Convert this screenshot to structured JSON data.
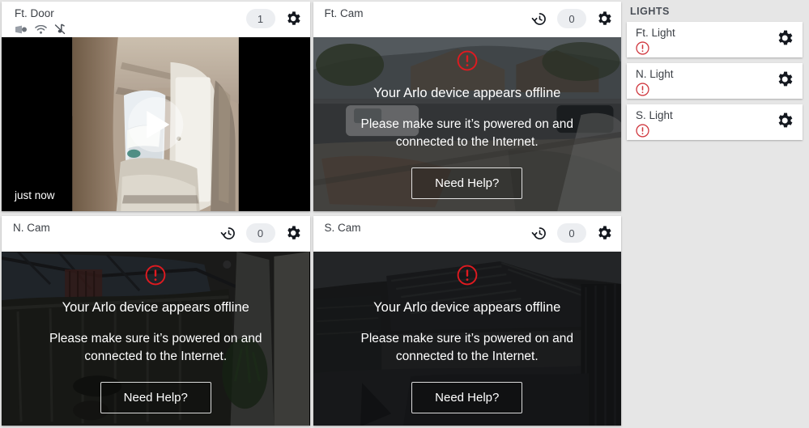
{
  "colors": {
    "page_background": "#e6e6e6",
    "card_background": "#ffffff",
    "status_online": "#3fc9a0",
    "warning_red": "#e01a20",
    "badge_background": "#eceef1",
    "text_primary": "#3b3f45"
  },
  "cameras": [
    {
      "title": "Ft. Door",
      "type": "doorbell",
      "status_bar": true,
      "status_icons": [
        "battery-icon",
        "wifi-icon",
        "audio-muted-icon"
      ],
      "has_history_icon": false,
      "history_icon": "history-icon",
      "badge_count": "1",
      "settings_icon": "gear-icon",
      "timestamp": "just now",
      "play_icon": "play-icon",
      "offline": false
    },
    {
      "title": "Ft. Cam",
      "type": "camera",
      "status_bar": false,
      "status_icons": [],
      "has_history_icon": true,
      "history_icon": "history-icon",
      "badge_count": "0",
      "settings_icon": "gear-icon",
      "offline": true,
      "offline_icon": "warning-circle-icon",
      "offline_title": "Your Arlo device appears offline",
      "offline_sub": "Please make sure it’s powered on and connected to the Internet.",
      "help_label": "Need Help?"
    },
    {
      "title": "N. Cam",
      "type": "camera",
      "status_bar": false,
      "status_icons": [],
      "has_history_icon": true,
      "history_icon": "history-icon",
      "badge_count": "0",
      "settings_icon": "gear-icon",
      "offline": true,
      "offline_icon": "warning-circle-icon",
      "offline_title": "Your Arlo device appears offline",
      "offline_sub": "Please make sure it’s powered on and connected to the Internet.",
      "help_label": "Need Help?"
    },
    {
      "title": "S. Cam",
      "type": "camera",
      "status_bar": false,
      "status_icons": [],
      "has_history_icon": true,
      "history_icon": "history-icon",
      "badge_count": "0",
      "settings_icon": "gear-icon",
      "offline": true,
      "offline_icon": "warning-circle-icon",
      "offline_title": "Your Arlo device appears offline",
      "offline_sub": "Please make sure it’s powered on and connected to the Internet.",
      "help_label": "Need Help?"
    }
  ],
  "lights": {
    "title": "LIGHTS",
    "items": [
      {
        "name": "Ft. Light",
        "status_icon": "warning-circle-icon",
        "settings_icon": "gear-icon"
      },
      {
        "name": "N. Light",
        "status_icon": "warning-circle-icon",
        "settings_icon": "gear-icon"
      },
      {
        "name": "S. Light",
        "status_icon": "warning-circle-icon",
        "settings_icon": "gear-icon"
      }
    ]
  }
}
